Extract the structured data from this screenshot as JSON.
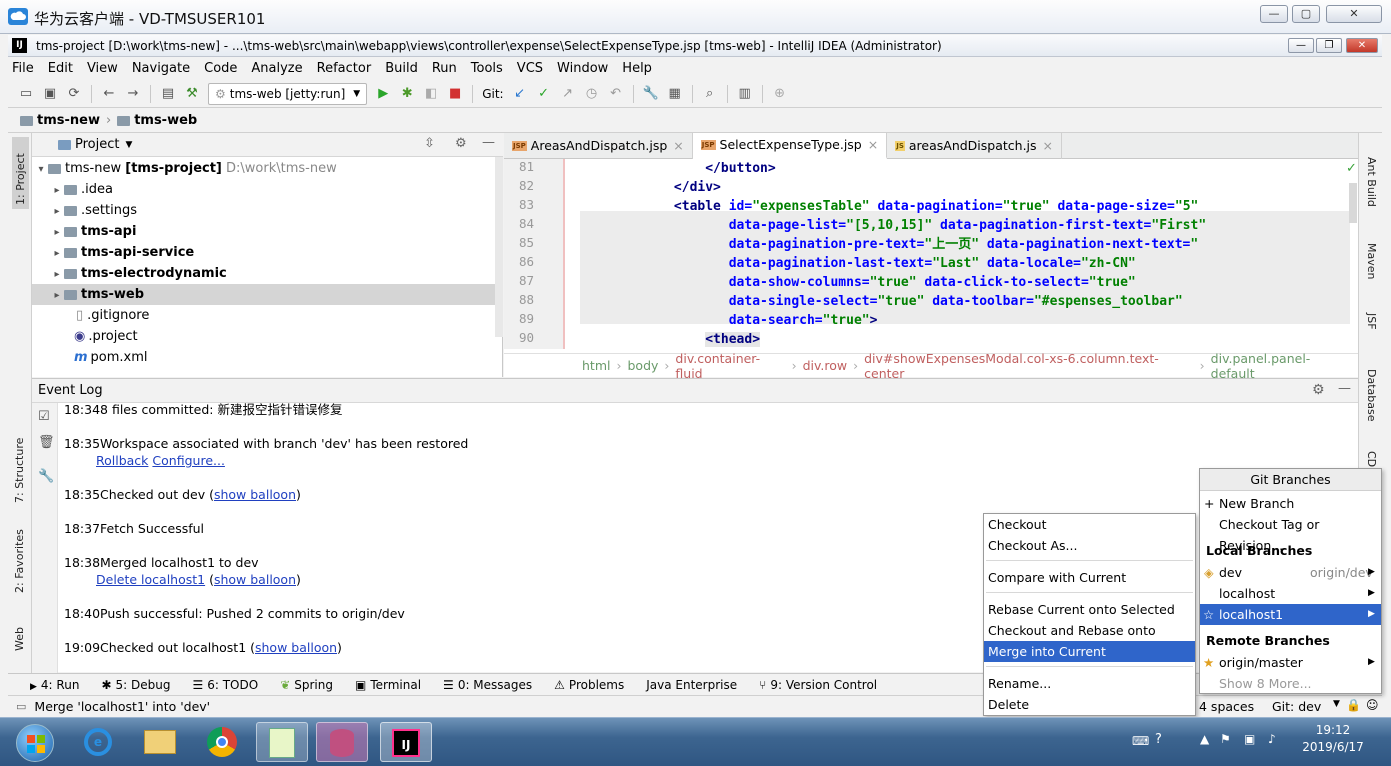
{
  "remote": {
    "title": "华为云客户端 - VD-TMSUSER101",
    "min": "—",
    "max": "▢",
    "close": "✕"
  },
  "idea": {
    "title": "tms-project [D:\\work\\tms-new] - ...\\tms-web\\src\\main\\webapp\\views\\controller\\expense\\SelectExpenseType.jsp [tms-web] - IntelliJ IDEA (Administrator)",
    "logo": "IJ"
  },
  "menu": [
    "File",
    "Edit",
    "View",
    "Navigate",
    "Code",
    "Analyze",
    "Refactor",
    "Build",
    "Run",
    "Tools",
    "VCS",
    "Window",
    "Help"
  ],
  "toolbar": {
    "run_config": "tms-web [jetty:run]",
    "git_label": "Git:"
  },
  "nav": {
    "crumb1": "tms-new",
    "crumb2": "tms-web"
  },
  "leftstrip": {
    "project": "1: Project",
    "structure": "7: Structure",
    "favorites": "2: Favorites",
    "web": "Web"
  },
  "rightstrip": {
    "ant": "Ant Build",
    "maven": "Maven",
    "jsf": "JSF",
    "database": "Database",
    "cd": "CD"
  },
  "project": {
    "header": "Project",
    "tree": [
      {
        "label": "tms-new",
        "bold_suffix": "[tms-project]",
        "path": "D:\\work\\tms-new"
      },
      {
        "label": ".idea"
      },
      {
        "label": ".settings"
      },
      {
        "label": "tms-api"
      },
      {
        "label": "tms-api-service"
      },
      {
        "label": "tms-electrodynamic"
      },
      {
        "label": "tms-web"
      },
      {
        "label": ".gitignore"
      },
      {
        "label": ".project"
      },
      {
        "label": "pom.xml"
      }
    ]
  },
  "editor": {
    "tabs": [
      "AreasAndDispatch.jsp",
      "SelectExpenseType.jsp",
      "areasAndDispatch.js"
    ],
    "line_numbers": [
      "81",
      "82",
      "83",
      "84",
      "85",
      "86",
      "87",
      "88",
      "89",
      "90"
    ],
    "breadcrumbs": [
      "html",
      "body",
      "div.container-fluid",
      "div.row",
      "div#showExpensesModal.col-xs-6.column.text-center",
      "div.panel.panel-default"
    ]
  },
  "eventlog": {
    "title": "Event Log",
    "entries": [
      {
        "time": "18:34",
        "text": "8 files committed: 新建报空指针错误修复"
      },
      {
        "time": "18:35",
        "text": "Workspace associated with branch   'dev' has been restored",
        "link1": "Rollback",
        "link2": "Configure..."
      },
      {
        "time": "18:35",
        "text": "Checked out dev (",
        "link1": "show balloon",
        "tail": ")"
      },
      {
        "time": "18:37",
        "text": "Fetch Successful"
      },
      {
        "time": "18:38",
        "text": "Merged localhost1 to dev",
        "link1": "Delete localhost1",
        "link2": "show balloon"
      },
      {
        "time": "18:40",
        "text": "Push successful: Pushed 2 commits to origin/dev"
      },
      {
        "time": "19:09",
        "text": "Checked out localhost1 (",
        "link1": "show balloon",
        "tail": ")"
      }
    ]
  },
  "toolwindows": [
    "4: Run",
    "5: Debug",
    "6: TODO",
    "Spring",
    "Terminal",
    "0: Messages",
    "Problems",
    "Java Enterprise",
    "9: Version Control"
  ],
  "status": {
    "message": "Merge 'localhost1' into 'dev'",
    "indent": "4 spaces",
    "git": "Git: dev"
  },
  "context_menu": {
    "items": [
      "Checkout",
      "Checkout As...",
      "Compare with Current",
      "Rebase Current onto Selected",
      "Checkout and Rebase onto Current",
      "Merge into Current",
      "Rename...",
      "Delete"
    ],
    "highlighted": "Merge into Current"
  },
  "git_branches": {
    "title": "Git Branches",
    "new_branch": "New Branch",
    "checkout_tag": "Checkout Tag or Revision...",
    "local_header": "Local Branches",
    "local": [
      {
        "name": "dev",
        "tracking": "origin/dev"
      },
      {
        "name": "localhost"
      },
      {
        "name": "localhost1"
      }
    ],
    "remote_header": "Remote Branches",
    "remote": [
      {
        "name": "origin/master"
      }
    ],
    "show_more": "Show 8 More..."
  },
  "taskbar": {
    "time": "19:12",
    "date": "2019/6/17"
  },
  "colors": {
    "highlight": "#2f65ca",
    "tag": "#000080",
    "attr": "#0000ff",
    "value": "#008000"
  }
}
